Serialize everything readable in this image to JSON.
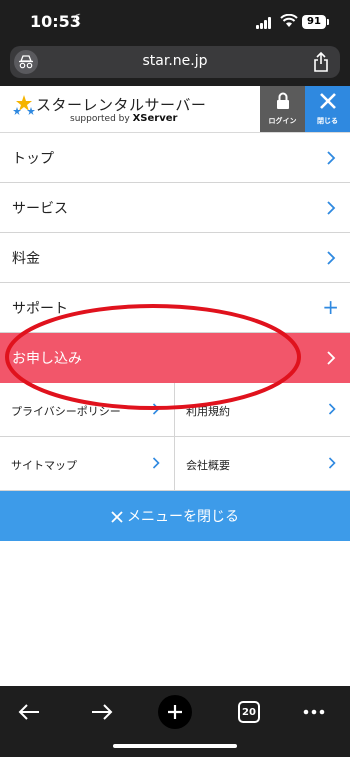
{
  "status_bar": {
    "time": "10:53",
    "battery": "91"
  },
  "browser": {
    "url": "star.ne.jp",
    "tab_count": "20"
  },
  "site_header": {
    "logo_title": "スターレンタルサーバー",
    "logo_supported": "supported by",
    "logo_brand": "XServer",
    "login_label": "ログイン",
    "close_label": "閉じる"
  },
  "menu": {
    "items": [
      {
        "label": "トップ"
      },
      {
        "label": "サービス"
      },
      {
        "label": "料金"
      },
      {
        "label": "サポート"
      },
      {
        "label": "お申し込み"
      }
    ],
    "grid": [
      {
        "label": "プライバシーポリシー"
      },
      {
        "label": "利用規約"
      },
      {
        "label": "サイトマップ"
      },
      {
        "label": "会社概要"
      }
    ],
    "close_menu_label": "メニューを閉じる"
  },
  "colors": {
    "accent_blue": "#2f89e0",
    "apply_red": "#f2566a",
    "close_bar_blue": "#3d9be9",
    "annotation_red": "#e0121d"
  }
}
